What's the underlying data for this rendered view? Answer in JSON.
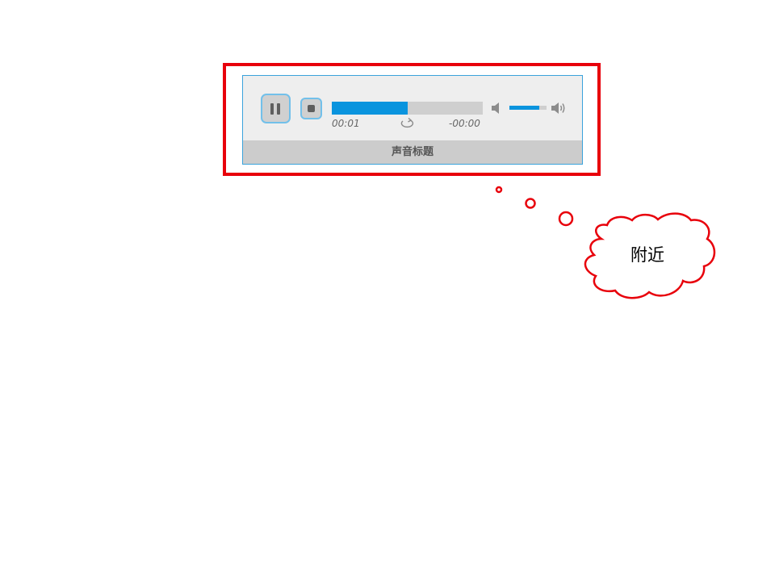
{
  "player": {
    "title": "声音标题",
    "current_time": "00:01",
    "remaining_time": "-00:00",
    "progress_fraction": 0.5,
    "volume_fraction": 0.8,
    "state": "playing",
    "controls": {
      "pause_icon": "pause-icon",
      "stop_icon": "stop-icon",
      "loop_icon": "loop-icon",
      "mute_icon": "speaker-mute-icon",
      "loud_icon": "speaker-loud-icon"
    }
  },
  "callout": {
    "text": "附近"
  },
  "colors": {
    "highlight": "#e8000b",
    "accent": "#0a94de",
    "player_border": "#3ba3dc",
    "player_bg": "#eeeeee",
    "title_bar_bg": "#cccccc"
  }
}
